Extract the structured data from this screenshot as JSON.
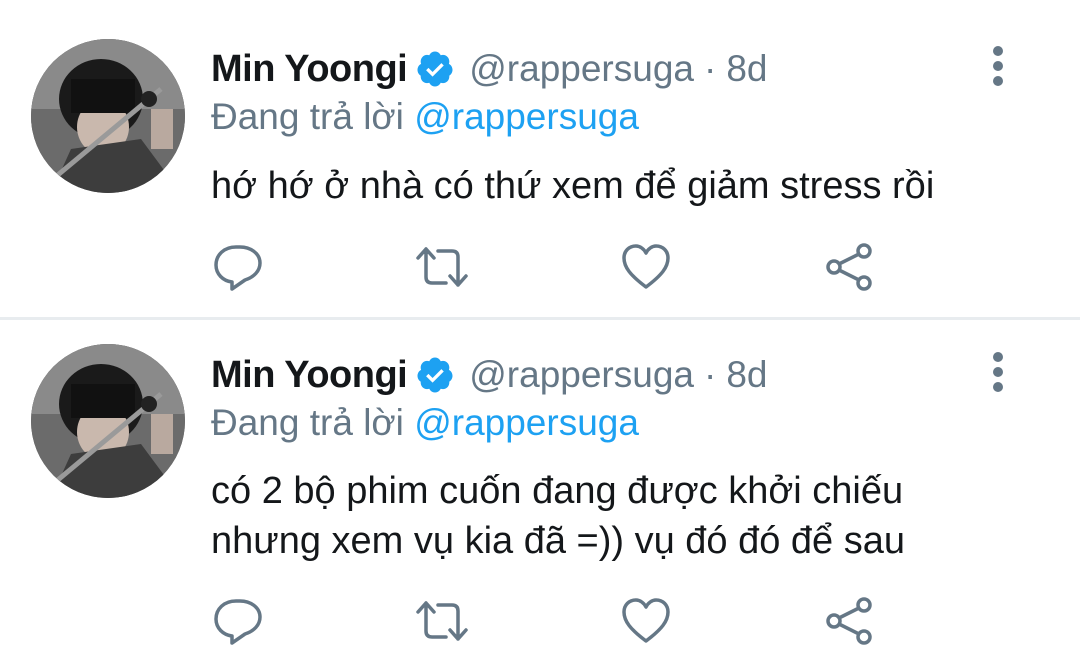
{
  "colors": {
    "text": "#14171a",
    "secondary": "#657786",
    "accent": "#1da1f2",
    "divider": "#e8ecef"
  },
  "tweets": [
    {
      "author_name": "Min Yoongi",
      "handle": "@rappersuga",
      "separator": "·",
      "time": "8d",
      "replying_prefix": "Đang trả lời",
      "replying_to": "@rappersuga",
      "text_lines": [
        "hớ hớ ở nhà có thứ xem để giảm stress rồi"
      ],
      "actions": [
        "reply-icon",
        "retweet-icon",
        "like-icon",
        "share-icon"
      ]
    },
    {
      "author_name": "Min Yoongi",
      "handle": "@rappersuga",
      "separator": "·",
      "time": "8d",
      "replying_prefix": "Đang trả lời",
      "replying_to": "@rappersuga",
      "text_lines": [
        "có 2 bộ phim cuốn đang được khởi chiếu",
        "nhưng xem vụ kia đã =)) vụ đó đó để sau"
      ],
      "actions": [
        "reply-icon",
        "retweet-icon",
        "like-icon",
        "share-icon"
      ]
    }
  ]
}
